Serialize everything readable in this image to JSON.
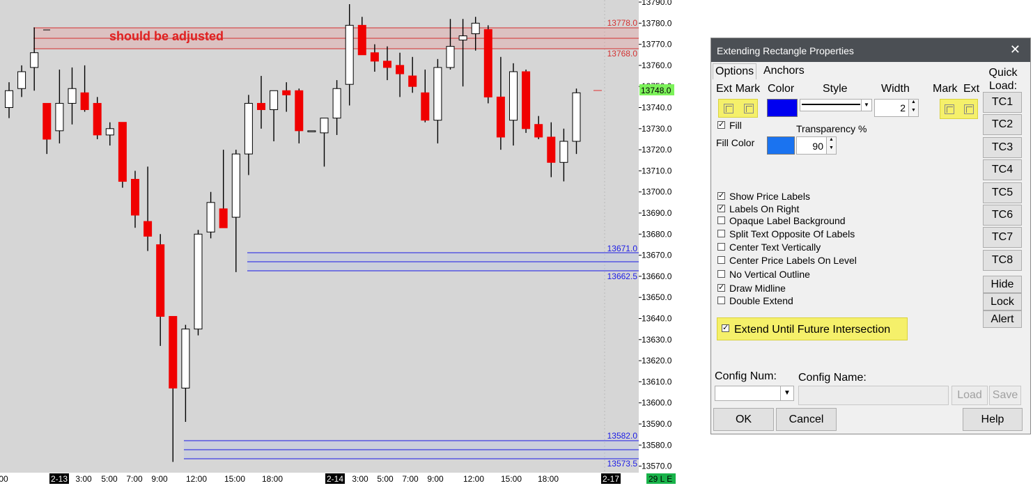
{
  "chart": {
    "price_axis_labels": [
      "13790.0",
      "13780.0",
      "13770.0",
      "13760.0",
      "13750.0",
      "13740.0",
      "13730.0",
      "13720.0",
      "13710.0",
      "13700.0",
      "13690.0",
      "13680.0",
      "13670.0",
      "13660.0",
      "13650.0",
      "13640.0",
      "13630.0",
      "13620.0",
      "13610.0",
      "13600.0",
      "13590.0",
      "13580.0",
      "13570.0"
    ],
    "current_price_label": "13748.0",
    "annotation": "should be adjusted",
    "rect_upper": {
      "top_label": "13778.0",
      "bottom_label": "13768.0",
      "color": "#d43030"
    },
    "rect_middle": {
      "top_label": "13671.0",
      "bottom_label": "13662.5",
      "color": "#1a1ae6"
    },
    "rect_lower": {
      "top_label": "13582.0",
      "bottom_label": "13573.5",
      "color": "#1a1ae6"
    },
    "time_labels": [
      "00",
      "2-13",
      "3:00",
      "5:00",
      "7:00",
      "9:00",
      "12:00",
      "15:00",
      "18:00",
      "2-14",
      "3:00",
      "5:00",
      "7:00",
      "9:00",
      "12:00",
      "15:00",
      "18:00",
      "2-17"
    ],
    "status_badge": "29 L E"
  },
  "chart_data": {
    "type": "candlestick",
    "ylim": [
      13570,
      13790
    ],
    "candles": [
      {
        "o": 13740,
        "h": 13752,
        "l": 13735,
        "c": 13748
      },
      {
        "o": 13749,
        "h": 13760,
        "l": 13745,
        "c": 13757
      },
      {
        "o": 13759,
        "h": 13778,
        "l": 13748,
        "c": 13766
      },
      {
        "o": 13742,
        "h": 13742,
        "l": 13718,
        "c": 13725
      },
      {
        "o": 13729,
        "h": 13758,
        "l": 13723,
        "c": 13742
      },
      {
        "o": 13742,
        "h": 13759,
        "l": 13732,
        "c": 13749
      },
      {
        "o": 13747,
        "h": 13760,
        "l": 13738,
        "c": 13739
      },
      {
        "o": 13742,
        "h": 13745,
        "l": 13725,
        "c": 13727
      },
      {
        "o": 13727,
        "h": 13733,
        "l": 13722,
        "c": 13730
      },
      {
        "o": 13733,
        "h": 13733,
        "l": 13702,
        "c": 13705
      },
      {
        "o": 13706,
        "h": 13710,
        "l": 13683,
        "c": 13689
      },
      {
        "o": 13686,
        "h": 13712,
        "l": 13672,
        "c": 13679
      },
      {
        "o": 13675,
        "h": 13680,
        "l": 13627,
        "c": 13641
      },
      {
        "o": 13641,
        "h": 13641,
        "l": 13572,
        "c": 13607
      },
      {
        "o": 13607,
        "h": 13637,
        "l": 13591,
        "c": 13635
      },
      {
        "o": 13635,
        "h": 13682,
        "l": 13632,
        "c": 13680
      },
      {
        "o": 13681,
        "h": 13700,
        "l": 13678,
        "c": 13695
      },
      {
        "o": 13692,
        "h": 13720,
        "l": 13686,
        "c": 13683
      },
      {
        "o": 13688,
        "h": 13720,
        "l": 13662,
        "c": 13718
      },
      {
        "o": 13718,
        "h": 13746,
        "l": 13708,
        "c": 13742
      },
      {
        "o": 13742,
        "h": 13755,
        "l": 13730,
        "c": 13739
      },
      {
        "o": 13739,
        "h": 13748,
        "l": 13724,
        "c": 13748
      },
      {
        "o": 13748,
        "h": 13752,
        "l": 13738,
        "c": 13746
      },
      {
        "o": 13748,
        "h": 13749,
        "l": 13723,
        "c": 13729
      },
      {
        "o": 13729,
        "h": 13729,
        "l": 13729,
        "c": 13729
      },
      {
        "o": 13728,
        "h": 13733,
        "l": 13712,
        "c": 13735
      },
      {
        "o": 13735,
        "h": 13753,
        "l": 13727,
        "c": 13749
      },
      {
        "o": 13751,
        "h": 13789,
        "l": 13741,
        "c": 13779
      },
      {
        "o": 13779,
        "h": 13783,
        "l": 13765,
        "c": 13765
      },
      {
        "o": 13766,
        "h": 13770,
        "l": 13757,
        "c": 13762
      },
      {
        "o": 13762,
        "h": 13769,
        "l": 13753,
        "c": 13759
      },
      {
        "o": 13760,
        "h": 13766,
        "l": 13745,
        "c": 13756
      },
      {
        "o": 13755,
        "h": 13764,
        "l": 13747,
        "c": 13750
      },
      {
        "o": 13747,
        "h": 13758,
        "l": 13733,
        "c": 13734
      },
      {
        "o": 13734,
        "h": 13763,
        "l": 13723,
        "c": 13759
      },
      {
        "o": 13759,
        "h": 13782,
        "l": 13758,
        "c": 13769
      },
      {
        "o": 13772,
        "h": 13782,
        "l": 13750,
        "c": 13774
      },
      {
        "o": 13775,
        "h": 13783,
        "l": 13767,
        "c": 13780
      },
      {
        "o": 13777,
        "h": 13779,
        "l": 13742,
        "c": 13745
      },
      {
        "o": 13745,
        "h": 13764,
        "l": 13720,
        "c": 13726
      },
      {
        "o": 13734,
        "h": 13761,
        "l": 13722,
        "c": 13757
      },
      {
        "o": 13757,
        "h": 13758,
        "l": 13728,
        "c": 13730
      },
      {
        "o": 13732,
        "h": 13736,
        "l": 13725,
        "c": 13726
      },
      {
        "o": 13726,
        "h": 13733,
        "l": 13707,
        "c": 13714
      },
      {
        "o": 13714,
        "h": 13730,
        "l": 13705,
        "c": 13724
      },
      {
        "o": 13724,
        "h": 13749,
        "l": 13718,
        "c": 13747
      }
    ]
  },
  "dialog": {
    "title": "Extending Rectangle Properties",
    "close_glyph": "✕",
    "tabs": [
      "Options",
      "Anchors"
    ],
    "col_ext_mark": "Ext Mark",
    "col_color": "Color",
    "col_style": "Style",
    "col_width": "Width",
    "col_mark_ext": "Mark  Ext",
    "width_value": "2",
    "fill_label": "Fill",
    "fill_checked": true,
    "transparency_label": "Transparency %",
    "fill_color_label": "Fill Color",
    "transparency_value": "90",
    "line_color": "#0000f0",
    "fill_color": "#1a73f0",
    "options": [
      {
        "label": "Show Price Labels",
        "checked": true
      },
      {
        "label": "Labels On Right",
        "checked": true
      },
      {
        "label": "Opaque Label Background",
        "checked": false
      },
      {
        "label": "Split Text Opposite Of Labels",
        "checked": false
      },
      {
        "label": "Center Text Vertically",
        "checked": false
      },
      {
        "label": "Center Price Labels On Level",
        "checked": false
      },
      {
        "label": "No Vertical Outline",
        "checked": false
      },
      {
        "label": "Draw Midline",
        "checked": true
      },
      {
        "label": "Double Extend",
        "checked": false
      }
    ],
    "extend_label": "Extend Until Future Intersection",
    "extend_checked": true,
    "quick_load_label": "Quick Load:",
    "quick_buttons": [
      "TC1",
      "TC2",
      "TC3",
      "TC4",
      "TC5",
      "TC6",
      "TC7",
      "TC8"
    ],
    "hide_label": "Hide",
    "lock_label": "Lock",
    "alert_label": "Alert",
    "config_num_label": "Config Num:",
    "config_name_label": "Config Name:",
    "load_label": "Load",
    "save_label": "Save",
    "ok_label": "OK",
    "cancel_label": "Cancel",
    "help_label": "Help"
  }
}
